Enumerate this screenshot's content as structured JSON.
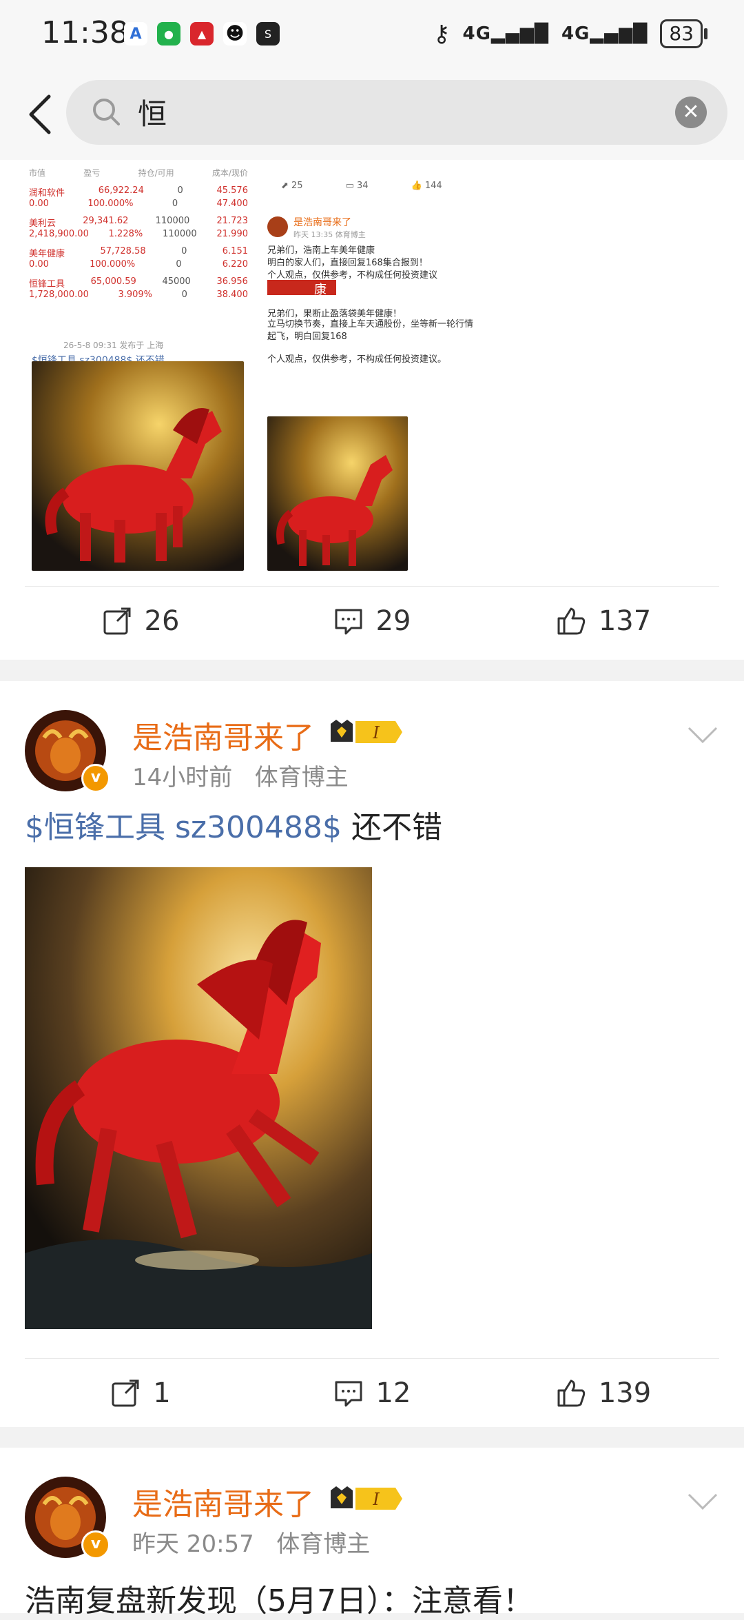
{
  "status_bar": {
    "time": "11:38",
    "network_1": "4G",
    "network_2": "4G",
    "battery": "83"
  },
  "search": {
    "query": "恒"
  },
  "collage": {
    "table_header": [
      "市值",
      "盈亏",
      "持仓/可用",
      "成本/现价"
    ],
    "rows": [
      {
        "name": "润和软件",
        "sub": "0.00",
        "v1": "66,922.24",
        "v2": "100.000%",
        "pos": "0",
        "pos2": "0",
        "c1": "45.576",
        "c2": "47.400"
      },
      {
        "name": "美利云",
        "sub": "2,418,900.00",
        "v1": "29,341.62",
        "v2": "1.228%",
        "pos": "110000",
        "pos2": "110000",
        "c1": "21.723",
        "c2": "21.990"
      },
      {
        "name": "美年健康",
        "sub": "0.00",
        "v1": "57,728.58",
        "v2": "100.000%",
        "pos": "0",
        "pos2": "0",
        "c1": "6.151",
        "c2": "6.220"
      },
      {
        "name": "恒锋工具",
        "sub": "1,728,000.00",
        "v1": "65,000.59",
        "v2": "3.909%",
        "pos": "45000",
        "pos2": "0",
        "c1": "36.956",
        "c2": "38.400"
      }
    ],
    "left_date": "26-5-8 09:31 发布于 上海",
    "left_caption": "$恒锋工具 sz300488$ 还不错",
    "right_stats": [
      "25",
      "34",
      "144"
    ],
    "right_user": "是浩南哥来了",
    "right_meta": "昨天 13:35  体育博主",
    "right_text_1": "兄弟们，浩南上车美年健康",
    "right_text_2": "明白的家人们，直接回复168集合报到！",
    "right_text_3": "个人观点，仅供参考，不构成任何投资建议",
    "right_text_4": "兄弟们，果断止盈落袋美年健康！",
    "right_text_5": "立马切换节奏，直接上车天通股份，坐等新一轮行情起飞，明白回复168",
    "right_text_6": "个人观点，仅供参考，不构成任何投资建议。",
    "right_img_char": "康"
  },
  "post1_actions": {
    "share": "26",
    "comment": "29",
    "like": "137"
  },
  "post2": {
    "user": "是浩南哥来了",
    "level": "I",
    "time": "14小时前",
    "category": "体育博主",
    "tag": "$恒锋工具 sz300488$",
    "text": " 还不错",
    "actions": {
      "share": "1",
      "comment": "12",
      "like": "139"
    }
  },
  "post3": {
    "user": "是浩南哥来了",
    "level": "I",
    "time": "昨天 20:57",
    "category": "体育博主",
    "text": "浩南复盘新发现（5月7日）：注意看！"
  },
  "colors": {
    "username": "#e86c17",
    "tag": "#4a6ea9",
    "red": "#d0312d"
  }
}
